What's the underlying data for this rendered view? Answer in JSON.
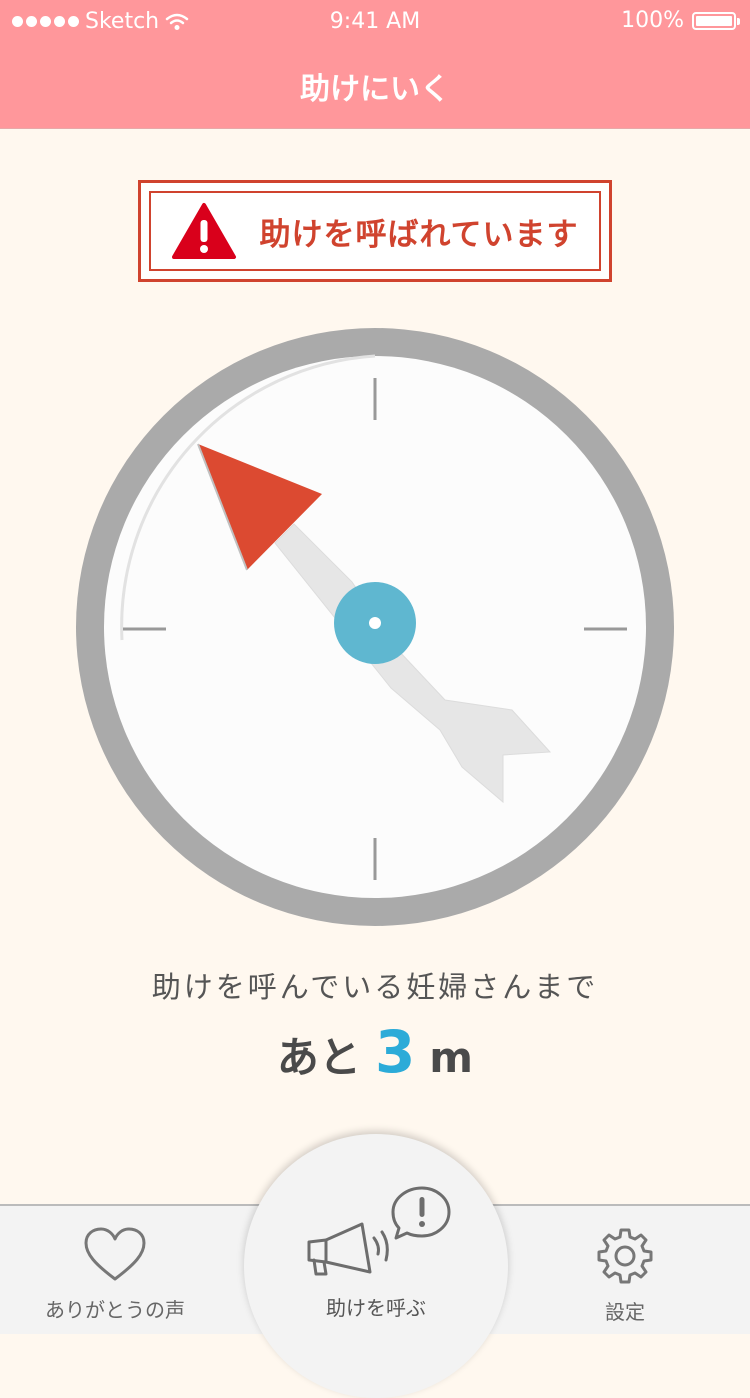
{
  "status": {
    "carrier": "Sketch",
    "time": "9:41 AM",
    "battery": "100%"
  },
  "nav": {
    "title": "助けにいく"
  },
  "alert": {
    "text": "助けを呼ばれています",
    "icon": "warning-icon"
  },
  "compass": {
    "needle_direction": "northwest",
    "colors": {
      "ring": "#aaaaaa",
      "needle_tip": "#dc4a31",
      "center": "#5fb7d0"
    }
  },
  "distance": {
    "caption": "助けを呼んでいる妊婦さんまで",
    "prefix": "あと",
    "value": "3",
    "unit": "m"
  },
  "tabs": {
    "thanks": {
      "label": "ありがとうの声",
      "icon": "heart-icon"
    },
    "call": {
      "label": "助けを呼ぶ",
      "icon": "megaphone-icon"
    },
    "settings": {
      "label": "設定",
      "icon": "gear-icon"
    }
  }
}
